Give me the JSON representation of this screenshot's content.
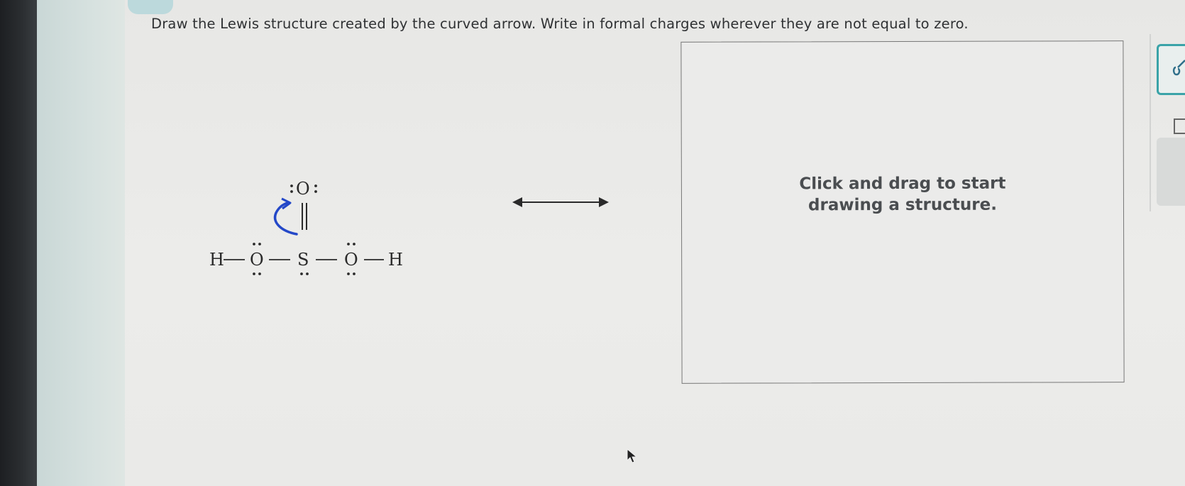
{
  "instruction": "Draw the Lewis structure created by the curved arrow. Write in formal charges wherever they are not equal to zero.",
  "molecule": {
    "top_oxygen": "O",
    "left_hydrogen": "H",
    "left_oxygen": "O",
    "sulfur": "S",
    "right_oxygen": "O",
    "right_hydrogen": "H"
  },
  "canvas": {
    "hint": "Click and drag to start\ndrawing a structure."
  },
  "colors": {
    "curved_arrow": "#2448c8",
    "tool_accent": "#3aa3a8"
  },
  "icons": {
    "resonance": "double-headed-arrow-icon",
    "tool": "drawing-tool-icon",
    "cursor": "mouse-pointer-icon"
  }
}
